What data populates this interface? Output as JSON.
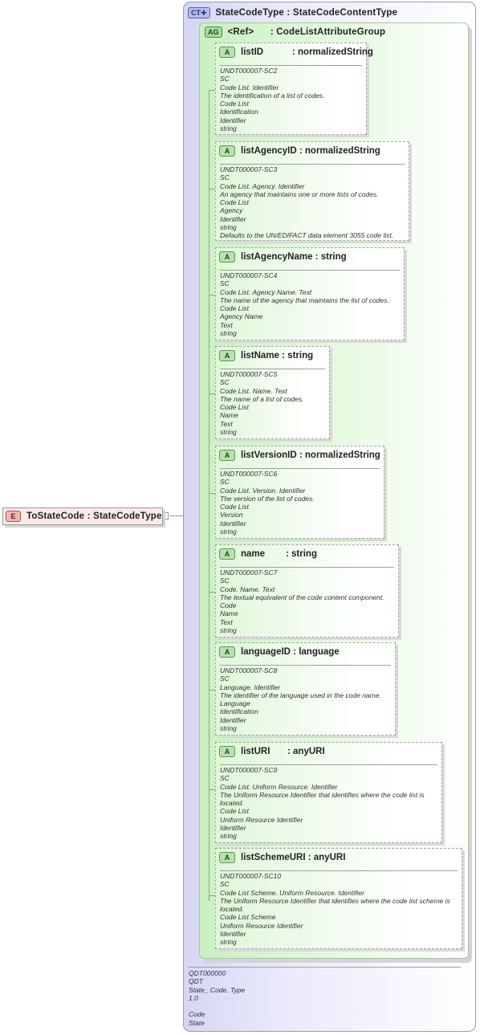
{
  "element": {
    "badge": "E",
    "name": "ToStateCode",
    "type": "StateCodeType"
  },
  "complex_type": {
    "badge": "CT",
    "name": "StateCodeType",
    "type": "StateCodeContentType",
    "doc": [
      "QDT000000",
      "QDT",
      "State_ Code. Type",
      "1.0",
      "",
      "Code",
      "State"
    ]
  },
  "attribute_group": {
    "badge": "AG",
    "ref_label": "<Ref>",
    "name": "CodeListAttributeGroup"
  },
  "attributes": [
    {
      "badge": "A",
      "name": "listID",
      "type": "normalizedString",
      "doc": [
        "UNDT000007-SC2",
        "SC",
        "Code List. Identifier",
        "The identification of a list of codes.",
        "Code List",
        "Identification",
        "Identifier",
        "string"
      ]
    },
    {
      "badge": "A",
      "name": "listAgencyID",
      "type": "normalizedString",
      "doc": [
        "UNDT000007-SC3",
        "SC",
        "Code List. Agency. Identifier",
        "An agency that maintains one or more lists of codes.",
        "Code List",
        "Agency",
        "Identifier",
        "string",
        "Defaults to the UN/EDIFACT data element 3055 code list."
      ]
    },
    {
      "badge": "A",
      "name": "listAgencyName",
      "type": "string",
      "doc": [
        "UNDT000007-SC4",
        "SC",
        "Code List. Agency Name. Text",
        "The name of the agency that maintains the list of codes.",
        "Code List",
        "Agency Name",
        "Text",
        "string"
      ]
    },
    {
      "badge": "A",
      "name": "listName",
      "type": "string",
      "doc": [
        "UNDT000007-SC5",
        "SC",
        "Code List. Name. Text",
        "The name of a list of codes.",
        "Code List",
        "Name",
        "Text",
        "string"
      ]
    },
    {
      "badge": "A",
      "name": "listVersionID",
      "type": "normalizedString",
      "doc": [
        "UNDT000007-SC6",
        "SC",
        "Code List. Version. Identifier",
        "The version of the list of codes.",
        "Code List",
        "Version",
        "Identifier",
        "string"
      ]
    },
    {
      "badge": "A",
      "name": "name",
      "type": "string",
      "doc": [
        "UNDT000007-SC7",
        "SC",
        "Code. Name. Text",
        "The textual equivalent of the code content component.",
        "Code",
        "Name",
        "Text",
        "string"
      ]
    },
    {
      "badge": "A",
      "name": "languageID",
      "type": "language",
      "doc": [
        "UNDT000007-SC8",
        "SC",
        "Language. Identifier",
        "The identifier of the language used in the code name.",
        "Language",
        "Identification",
        "Identifier",
        "string"
      ]
    },
    {
      "badge": "A",
      "name": "listURI",
      "type": "anyURI",
      "doc": [
        "UNDT000007-SC9",
        "SC",
        "Code List. Uniform Resource. Identifier",
        "The Uniform Resource Identifier that identifies where the code list is located.",
        "Code List",
        "Uniform Resource Identifier",
        "Identifier",
        "string"
      ]
    },
    {
      "badge": "A",
      "name": "listSchemeURI",
      "type": "anyURI",
      "doc": [
        "UNDT000007-SC10",
        "SC",
        "Code List Scheme. Uniform Resource. Identifier",
        "The Uniform Resource Identifier that identifies where the code list scheme is located.",
        "Code List Scheme",
        "Uniform Resource Identifier",
        "Identifier",
        "string"
      ]
    }
  ]
}
